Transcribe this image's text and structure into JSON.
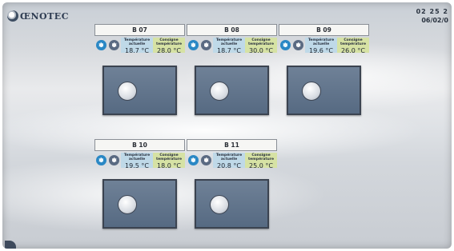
{
  "header": {
    "brand": "ŒNOTEC",
    "tagline": "",
    "time": "02  25  2",
    "date": "06/02/0"
  },
  "labels": {
    "actual": "Température actuelle",
    "setpoint": "Consigne température"
  },
  "zones": [
    {
      "name": "B 07",
      "actual": "18.7 °C",
      "setpoint": "28.0 °C"
    },
    {
      "name": "B 08",
      "actual": "18.7 °C",
      "setpoint": "30.0 °C"
    },
    {
      "name": "B 09",
      "actual": "19.6 °C",
      "setpoint": "26.0 °C"
    },
    {
      "name": "B 10",
      "actual": "19.5 °C",
      "setpoint": "18.0 °C"
    },
    {
      "name": "B 11",
      "actual": "20.8 °C",
      "setpoint": "25.0 °C"
    }
  ],
  "icons": [
    "fan-icon",
    "cooling-icon",
    "knob-icon",
    "logo-icon"
  ],
  "colors": {
    "actual_bg": "#bfd9e8",
    "setpoint_bg": "#d6e2a4",
    "panel": "#5f7289"
  }
}
